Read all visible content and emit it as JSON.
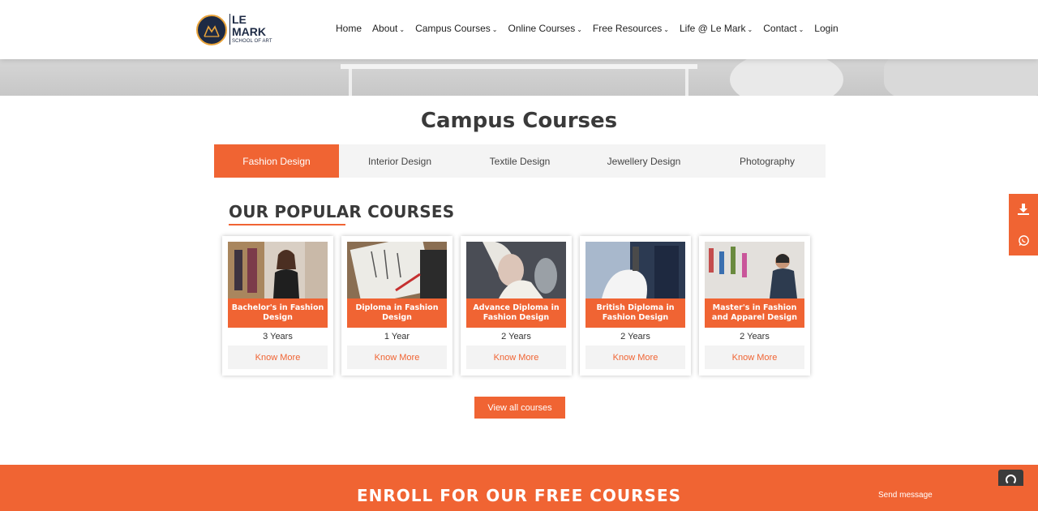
{
  "header": {
    "logo": {
      "line1": "LE",
      "line2": "MARK",
      "line3": "SCHOOL OF ART"
    },
    "nav": [
      {
        "label": "Home",
        "dropdown": false
      },
      {
        "label": "About",
        "dropdown": true
      },
      {
        "label": "Campus Courses",
        "dropdown": true
      },
      {
        "label": "Online Courses",
        "dropdown": true
      },
      {
        "label": "Free Resources",
        "dropdown": true
      },
      {
        "label": "Life @ Le Mark",
        "dropdown": true
      },
      {
        "label": "Contact",
        "dropdown": true
      },
      {
        "label": "Login",
        "dropdown": false
      }
    ],
    "caret": "⌄"
  },
  "campus": {
    "title": "Campus Courses",
    "tabs": [
      "Fashion Design",
      "Interior Design",
      "Textile Design",
      "Jewellery Design",
      "Photography"
    ],
    "active_tab": "Fashion Design"
  },
  "popular": {
    "heading": "OUR POPULAR COURSES",
    "courses": [
      {
        "title": "Bachelor's in Fashion Design",
        "duration": "3 Years",
        "cta": "Know More"
      },
      {
        "title": "Diploma in Fashion Design",
        "duration": "1 Year",
        "cta": "Know More"
      },
      {
        "title": "Advance Diploma in Fashion Design",
        "duration": "2 Years",
        "cta": "Know More"
      },
      {
        "title": "British Diploma in Fashion Design",
        "duration": "2 Years",
        "cta": "Know More"
      },
      {
        "title": "Master's in Fashion and Apparel Design",
        "duration": "2 Years",
        "cta": "Know More"
      }
    ],
    "view_all": "View all courses"
  },
  "side": {
    "icons": [
      "download-icon",
      "whatsapp-icon"
    ]
  },
  "enroll": {
    "title": "ENROLL FOR OUR FREE COURSES",
    "send_message": "Send message"
  },
  "colors": {
    "accent": "#f06433",
    "navy": "#1d2a44"
  }
}
